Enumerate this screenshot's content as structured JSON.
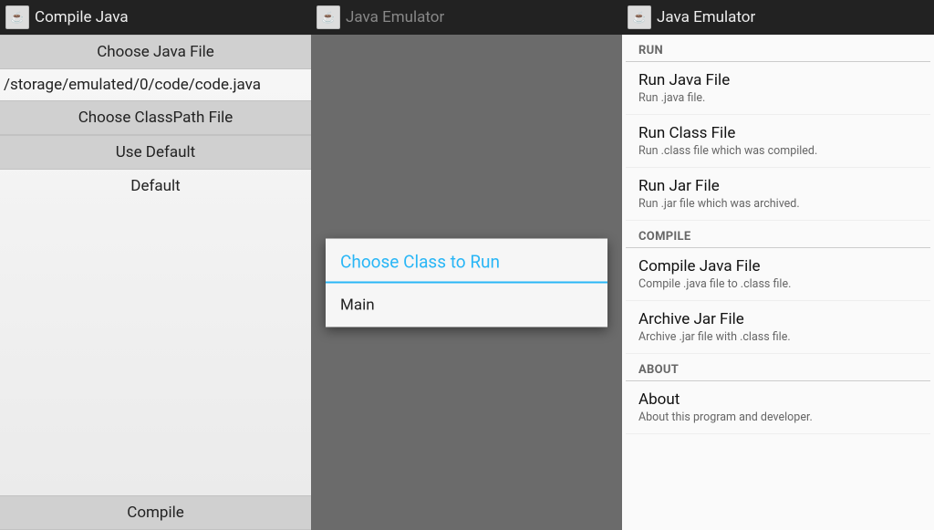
{
  "screen1": {
    "title": "Compile Java",
    "choose_java_label": "Choose Java File",
    "file_path": "/storage/emulated/0/code/code.java",
    "choose_classpath_label": "Choose ClassPath File",
    "use_default_label": "Use Default",
    "default_text": "Default",
    "compile_label": "Compile"
  },
  "screen2": {
    "title": "Java Emulator",
    "dialog_title": "Choose Class to Run",
    "dialog_items": [
      "Main"
    ]
  },
  "screen3": {
    "title": "Java Emulator",
    "sections": [
      {
        "header": "RUN",
        "items": [
          {
            "title": "Run Java File",
            "desc": "Run .java file."
          },
          {
            "title": "Run Class File",
            "desc": "Run .class file which was compiled."
          },
          {
            "title": "Run Jar File",
            "desc": "Run .jar file which was archived."
          }
        ]
      },
      {
        "header": "COMPILE",
        "items": [
          {
            "title": "Compile Java File",
            "desc": "Compile .java file to .class file."
          },
          {
            "title": "Archive Jar File",
            "desc": "Archive .jar file with .class file."
          }
        ]
      },
      {
        "header": "ABOUT",
        "items": [
          {
            "title": "About",
            "desc": "About this program and developer."
          }
        ]
      }
    ]
  },
  "icon_glyph": "☕"
}
